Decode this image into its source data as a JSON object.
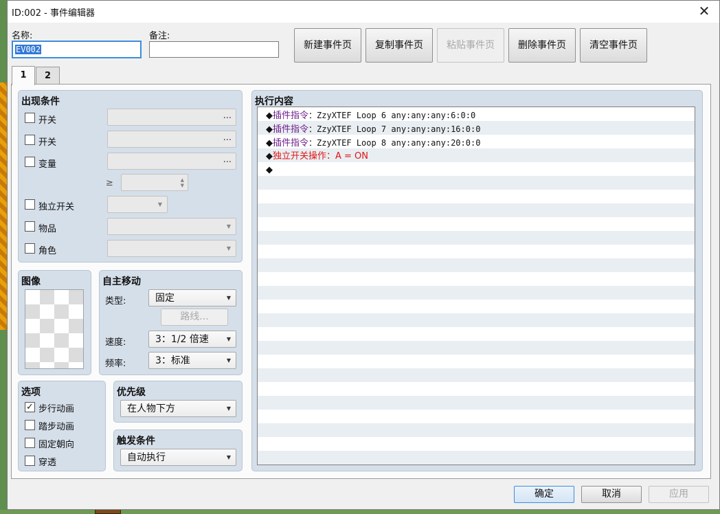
{
  "window": {
    "title": "ID:002 - 事件编辑器",
    "close_glyph": "✕"
  },
  "header": {
    "name_label": "名称:",
    "name_value": "EV002",
    "note_label": "备注:",
    "note_value": "",
    "buttons": {
      "new_page": "新建事件页",
      "copy_page": "复制事件页",
      "paste_page": "粘贴事件页",
      "delete_page": "删除事件页",
      "clear_page": "清空事件页"
    }
  },
  "tabs": [
    "1",
    "2"
  ],
  "conditions": {
    "title": "出现条件",
    "switch1_label": "开关",
    "switch2_label": "开关",
    "variable_label": "变量",
    "ge_symbol": "≥",
    "self_switch_label": "独立开关",
    "item_label": "物品",
    "actor_label": "角色",
    "ellipsis": "..."
  },
  "image": {
    "title": "图像"
  },
  "autonomous": {
    "title": "自主移动",
    "type_label": "类型:",
    "type_value": "固定",
    "route_button": "路线...",
    "speed_label": "速度:",
    "speed_value": "3：1/2 倍速",
    "freq_label": "频率:",
    "freq_value": "3：标准"
  },
  "options": {
    "title": "选项",
    "walking": {
      "label": "步行动画",
      "checked": true
    },
    "stepping": {
      "label": "踏步动画",
      "checked": false
    },
    "direction_fix": {
      "label": "固定朝向",
      "checked": false
    },
    "through": {
      "label": "穿透",
      "checked": false
    }
  },
  "priority": {
    "title": "优先级",
    "value": "在人物下方"
  },
  "trigger": {
    "title": "触发条件",
    "value": "自动执行"
  },
  "contents": {
    "title": "执行内容",
    "diamond": "◆",
    "plugin_label": "插件指令",
    "cmd1": "：ZzyXTEF Loop 6 any:any:any:6:0:0",
    "cmd2": "：ZzyXTEF Loop 7 any:any:any:16:0:0",
    "cmd3": "：ZzyXTEF Loop 8 any:any:any:20:0:0",
    "cmd4": "独立开关操作：A = ON"
  },
  "footer": {
    "ok": "确定",
    "cancel": "取消",
    "apply": "应用"
  },
  "colors": {
    "accent": "#3c8dde",
    "group_bg": "#d5dfea",
    "plugin_text": "#6d1d8a",
    "switch_text": "#e01616"
  }
}
